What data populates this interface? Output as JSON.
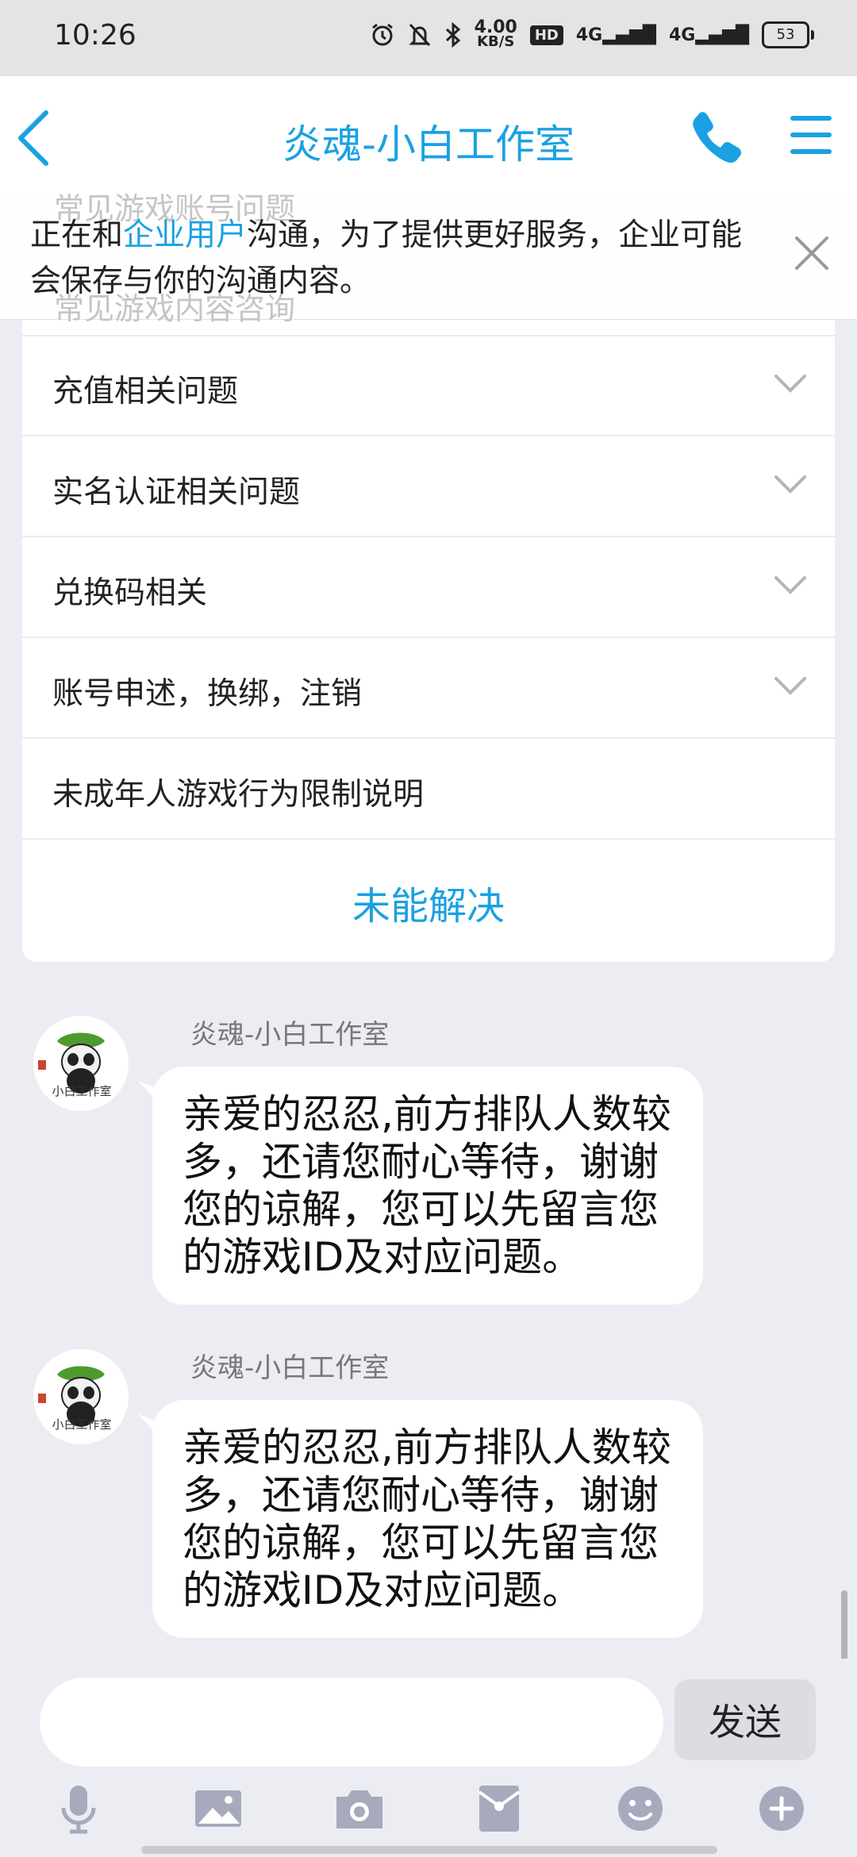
{
  "status_bar": {
    "time": "10:26",
    "speed_value": "4.00",
    "speed_unit": "KB/S",
    "hd_label": "HD",
    "signal1": "4G",
    "signal2": "4G",
    "battery": "53",
    "icons": [
      "alarm-icon",
      "mute-bell-icon",
      "bluetooth-icon"
    ]
  },
  "header": {
    "title": "炎魂-小白工作室",
    "back_icon": "chevron-left-icon",
    "phone_icon": "phone-icon",
    "menu_icon": "hamburger-icon"
  },
  "notice": {
    "ghost_row_1": "常见游戏账号问题",
    "ghost_row_2": "常见游戏内容咨询",
    "text_before": "正在和",
    "link": "企业用户",
    "text_after": "沟通，为了提供更好服务，企业可能会保存与你的沟通内容。",
    "close_icon": "close-icon"
  },
  "faq": {
    "items": [
      {
        "label": "充值相关问题",
        "expandable": true
      },
      {
        "label": "实名认证相关问题",
        "expandable": true
      },
      {
        "label": "兑换码相关",
        "expandable": true
      },
      {
        "label": "账号申述，换绑，注销",
        "expandable": true
      },
      {
        "label": "未成年人游戏行为限制说明",
        "expandable": false
      }
    ],
    "unresolved": "未能解决"
  },
  "messages": [
    {
      "sender": "炎魂-小白工作室",
      "text": "亲爱的忍忍,前方排队人数较多，还请您耐心等待，谢谢您的谅解，您可以先留言您的游戏ID及对应问题。",
      "avatar_caption": "小白工作室"
    },
    {
      "sender": "炎魂-小白工作室",
      "text": "亲爱的忍忍,前方排队人数较多，还请您耐心等待，谢谢您的谅解，您可以先留言您的游戏ID及对应问题。",
      "avatar_caption": "小白工作室"
    }
  ],
  "input": {
    "placeholder": "",
    "value": "",
    "send_label": "发送"
  },
  "toolbar": {
    "icons": [
      "microphone-icon",
      "image-icon",
      "camera-icon",
      "red-packet-icon",
      "emoji-icon",
      "plus-icon"
    ]
  },
  "colors": {
    "accent": "#1aa1e2",
    "background": "#ebedf3",
    "toolbar_icon": "#a6aabc"
  }
}
